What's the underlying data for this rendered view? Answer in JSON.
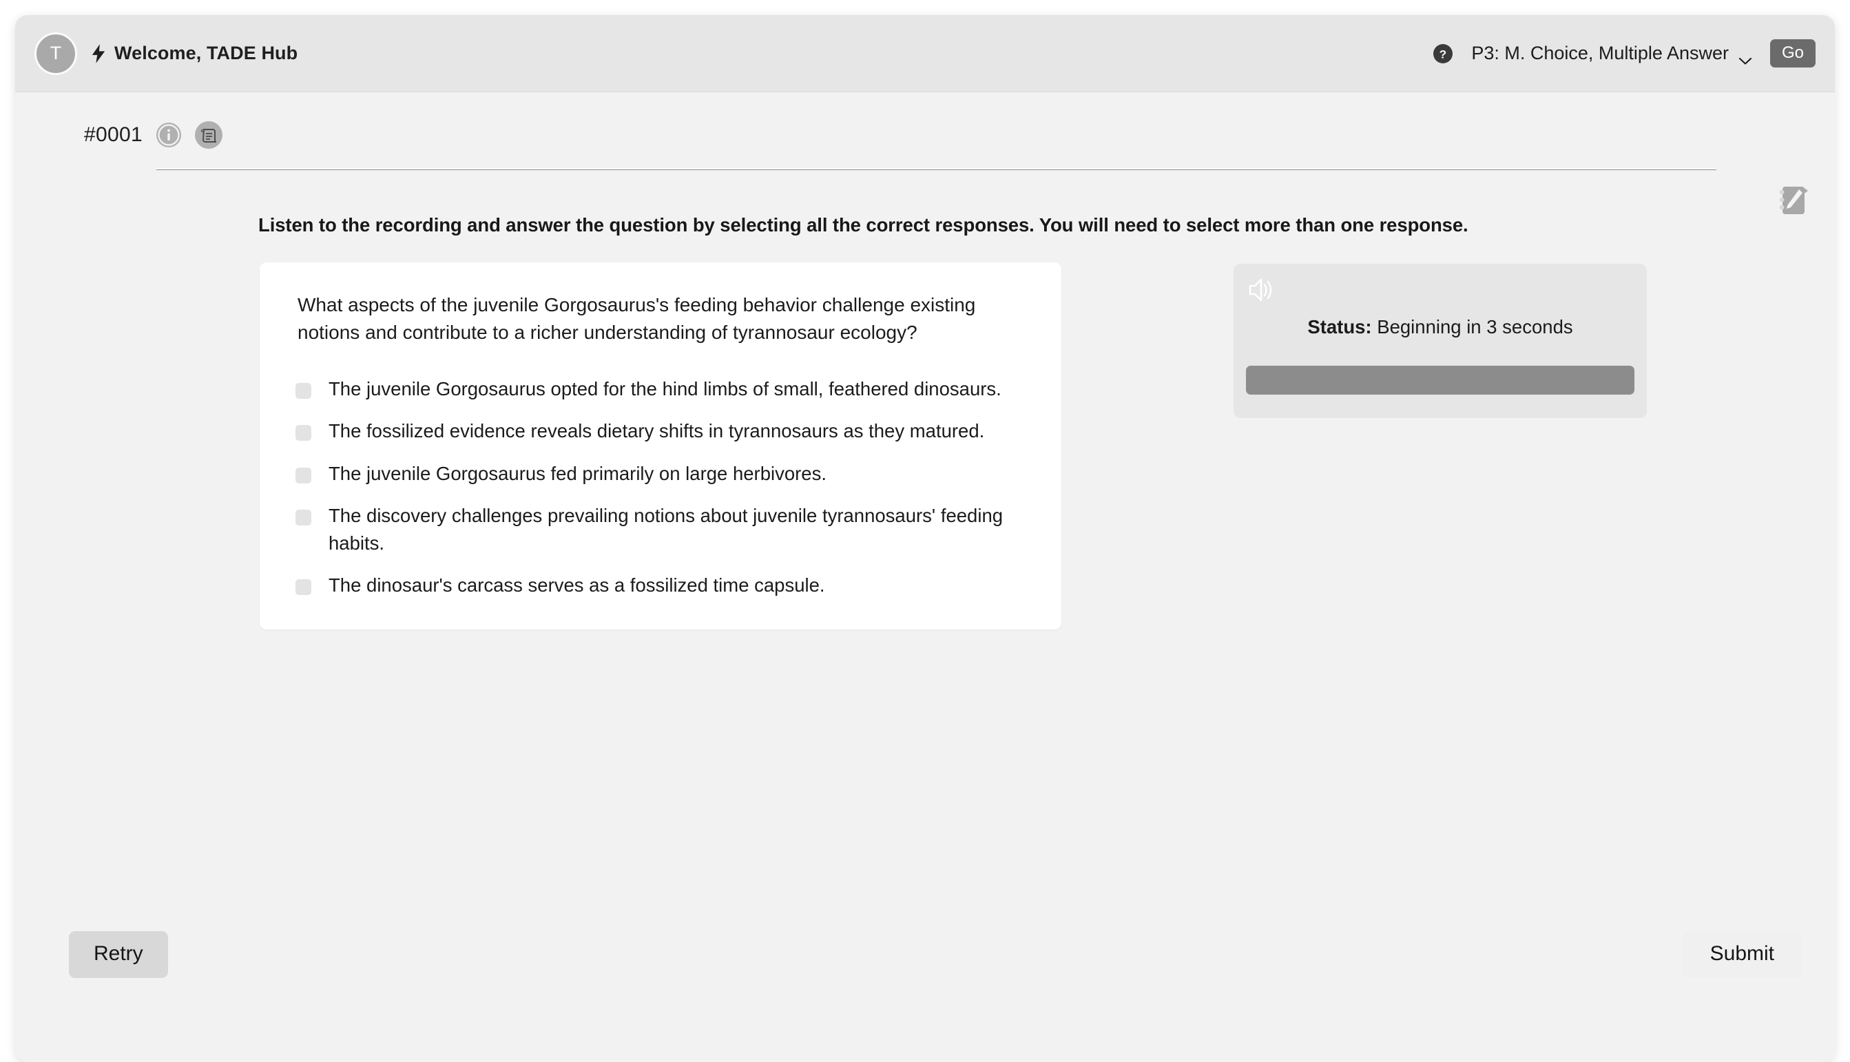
{
  "header": {
    "avatar_initial": "T",
    "bolt_icon": "lightning-bolt-icon",
    "welcome_text": "Welcome, TADE Hub",
    "help_icon": "help-circle-icon",
    "task_selected": "P3: M. Choice, Multiple Answer",
    "chevron_icon": "chevron-down-icon",
    "go_label": "Go"
  },
  "item": {
    "id_label": "#0001",
    "info_icon": "info-circle-icon",
    "transcript_icon": "transcript-scroll-icon"
  },
  "notes": {
    "icon": "notepad-pencil-icon"
  },
  "instruction": "Listen to the recording and answer the question by selecting all the correct responses. You will need to select more than one response.",
  "question": {
    "stem": "What aspects of the juvenile Gorgosaurus's feeding behavior challenge existing notions and contribute to a richer understanding of tyrannosaur ecology?",
    "options": [
      {
        "label": "The juvenile Gorgosaurus opted for the hind limbs of small, feathered dinosaurs.",
        "checked": false
      },
      {
        "label": "The fossilized evidence reveals dietary shifts in tyrannosaurs as they matured.",
        "checked": false
      },
      {
        "label": "The juvenile Gorgosaurus fed primarily on large herbivores.",
        "checked": false
      },
      {
        "label": "The discovery challenges prevailing notions about juvenile tyrannosaurs' feeding habits.",
        "checked": false
      },
      {
        "label": "The dinosaur's carcass serves as a fossilized time capsule.",
        "checked": false
      }
    ]
  },
  "audio": {
    "speaker_icon": "speaker-wave-icon",
    "status_label": "Status:",
    "status_value": "Beginning in 3 seconds",
    "progress_percent": 0
  },
  "footer": {
    "retry_label": "Retry",
    "submit_label": "Submit"
  },
  "colors": {
    "window_bg": "#f2f2f2",
    "header_bg": "#e6e6e6",
    "card_bg": "#ffffff",
    "accent_dark": "#6b6b6b",
    "progress_bar": "#8c8c8c"
  }
}
